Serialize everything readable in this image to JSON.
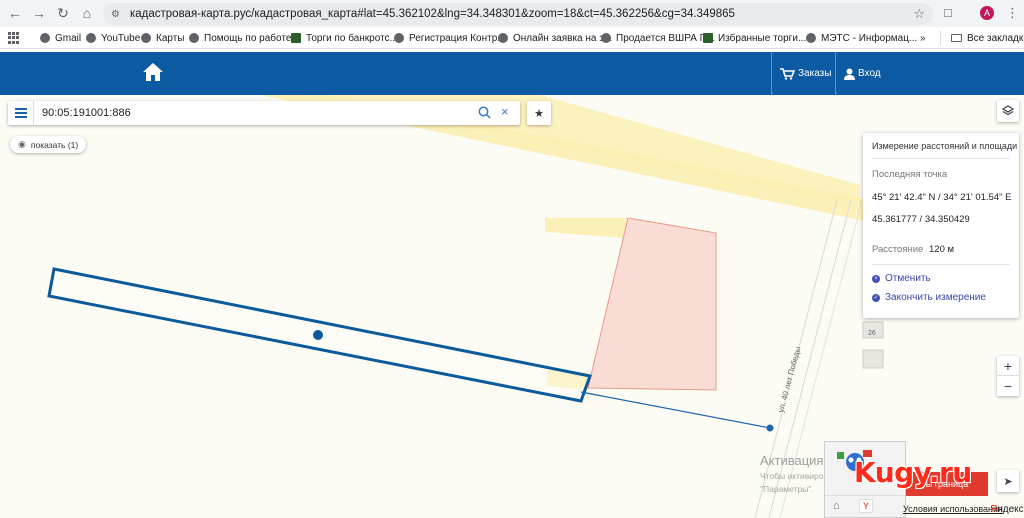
{
  "browser": {
    "url": "кадастровая-карта.рус/кадастровая_карта#lat=45.362102&lng=34.348301&zoom=18&ct=45.362256&cg=34.349865",
    "profile_initial": "A",
    "bookmarks": [
      {
        "label": "Gmail",
        "icon": "globe-icon"
      },
      {
        "label": "YouTube",
        "icon": "globe-icon"
      },
      {
        "label": "Карты",
        "icon": "globe-icon"
      },
      {
        "label": "Помощь по работе...",
        "icon": "globe-icon"
      },
      {
        "label": "Торги по банкротс...",
        "icon": "bookmark-logo-icon"
      },
      {
        "label": "Регистрация Контр...",
        "icon": "globe-icon"
      },
      {
        "label": "Онлайн заявка на з...",
        "icon": "globe-icon"
      },
      {
        "label": "Продается ВШРА П...",
        "icon": "globe-icon"
      },
      {
        "label": "Избранные торги...",
        "icon": "bookmark-logo-icon"
      },
      {
        "label": "МЭТС - Информац...",
        "icon": "globe-icon"
      }
    ],
    "overflow_label": "»",
    "all_bookmarks_label": "Все закладки"
  },
  "header": {
    "orders_label": "Заказы",
    "login_label": "Вход",
    "color": "#0c5aa1"
  },
  "search": {
    "value": "90:05:191001:886"
  },
  "show_button": {
    "label": "показать (1)"
  },
  "measure": {
    "title": "Измерение расстояний и площади",
    "last_point_label": "Последняя точка",
    "dms": "45° 21' 42.4\" N / 34° 21' 01.54\" E",
    "decimal": "45.361777 / 34.350429",
    "distance_label": "Расстояние",
    "distance_value": "120 м",
    "cancel_label": "Отменить",
    "finish_label": "Закончить измерение"
  },
  "map": {
    "street_label": "ул. 40 лет Победы",
    "house_number": "26",
    "parcel_color": "#0a5a9c",
    "neighbor_fill": "#f9dcd4",
    "road_fill": "#fbf1b8"
  },
  "windows_activation": {
    "title": "Активация W",
    "line1": "Чтобы активиро",
    "line2": "\"Параметры\"."
  },
  "overlay": {
    "watermark": "Kugy.ru",
    "red_button": "ы граница",
    "terms": "Условия использования",
    "yandex_y": "Я",
    "yandex_rest": "ндекс"
  }
}
